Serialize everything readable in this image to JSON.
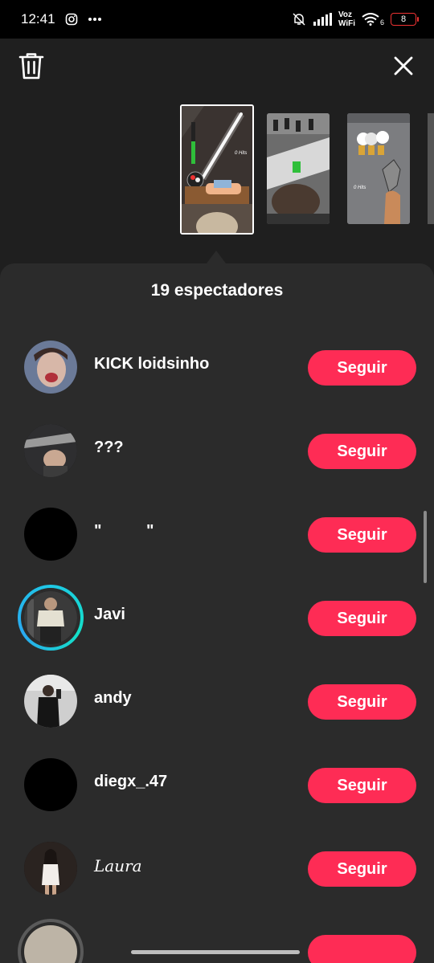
{
  "status_bar": {
    "time": "12:41",
    "left_icons": [
      "instagram-icon",
      "more-dots-icon"
    ],
    "voz": "Voz",
    "wifi": "WiFi",
    "wifi_sub": "6",
    "battery": "8",
    "colors": {
      "battery_outline": "#ee3333"
    }
  },
  "header": {
    "delete_icon": "trash-icon",
    "close_icon": "close-icon"
  },
  "thumbnails": [
    {
      "overlay_text": "0 Hits"
    },
    {
      "overlay_text": ""
    },
    {
      "overlay_text": "0 Hits"
    }
  ],
  "sheet": {
    "title": "19 espectadores"
  },
  "viewers": [
    {
      "name": "KICK loidsinho",
      "button": "Seguir"
    },
    {
      "name": "???",
      "button": "Seguir"
    },
    {
      "name": "\"          \"",
      "button": "Seguir"
    },
    {
      "name": "Javi",
      "button": "Seguir"
    },
    {
      "name": "andy",
      "button": "Seguir"
    },
    {
      "name": "diegx_.47",
      "button": "Seguir"
    },
    {
      "name": "Laura",
      "button": "Seguir"
    },
    {
      "name": "",
      "button": ""
    }
  ],
  "colors": {
    "follow_button": "#fe2c55",
    "sheet_bg": "#2b2b2b",
    "top_bg": "#1f1f1f",
    "story_ring": "#1ec8e6"
  }
}
